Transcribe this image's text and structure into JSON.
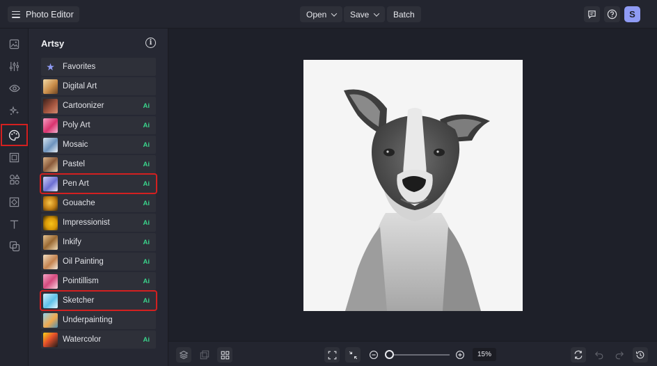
{
  "app": {
    "title": "Photo Editor"
  },
  "toolbar": {
    "open_label": "Open",
    "save_label": "Save",
    "batch_label": "Batch",
    "avatar_initial": "S"
  },
  "panel": {
    "title": "Artsy",
    "items": [
      {
        "label": "Favorites",
        "ai": ""
      },
      {
        "label": "Digital Art",
        "ai": ""
      },
      {
        "label": "Cartoonizer",
        "ai": "Ai"
      },
      {
        "label": "Poly Art",
        "ai": "Ai"
      },
      {
        "label": "Mosaic",
        "ai": "Ai"
      },
      {
        "label": "Pastel",
        "ai": "Ai"
      },
      {
        "label": "Pen Art",
        "ai": "Ai"
      },
      {
        "label": "Gouache",
        "ai": "Ai"
      },
      {
        "label": "Impressionist",
        "ai": "Ai"
      },
      {
        "label": "Inkify",
        "ai": "Ai"
      },
      {
        "label": "Oil Painting",
        "ai": "Ai"
      },
      {
        "label": "Pointillism",
        "ai": "Ai"
      },
      {
        "label": "Sketcher",
        "ai": "Ai"
      },
      {
        "label": "Underpainting",
        "ai": ""
      },
      {
        "label": "Watercolor",
        "ai": "Ai"
      }
    ]
  },
  "zoom": {
    "value": "15%"
  },
  "colors": {
    "accent": "#8f9bf4",
    "ai_badge": "#3ad38b",
    "highlight": "#d42020"
  }
}
